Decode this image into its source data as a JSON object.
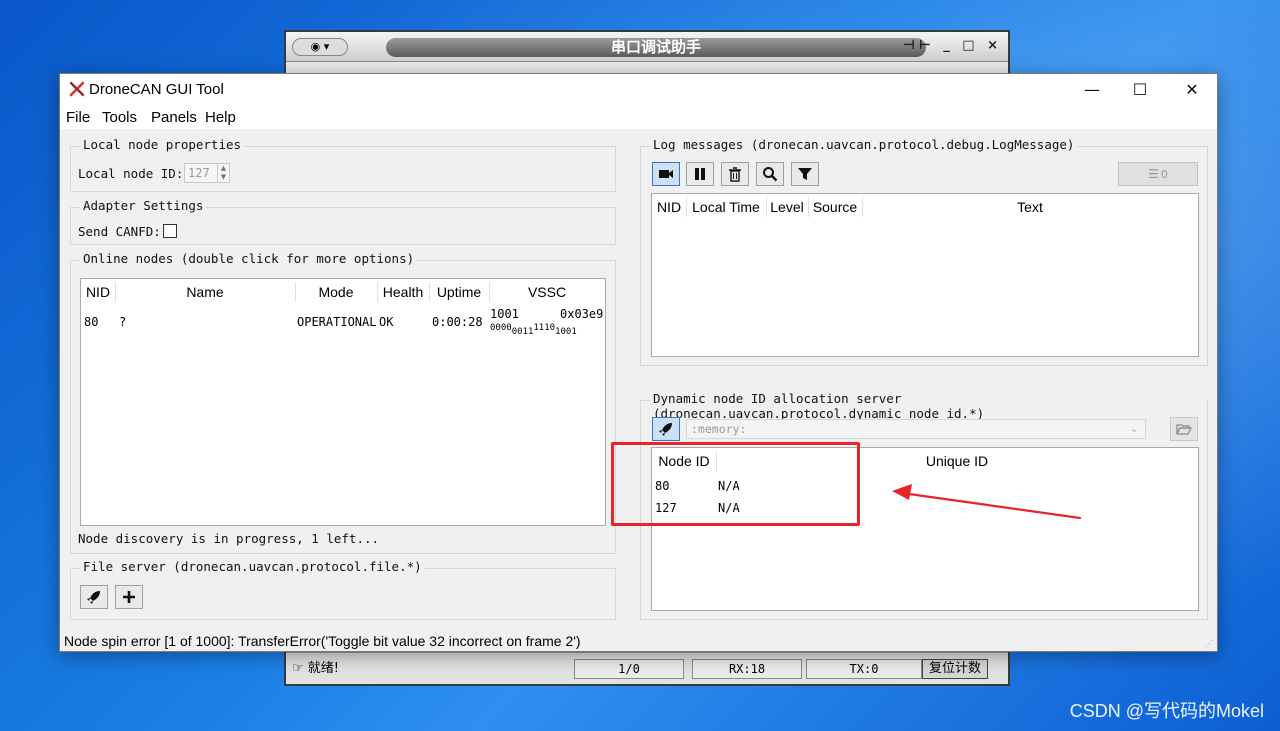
{
  "watermark": "CSDN @写代码的Mokel",
  "serial": {
    "title": "串口调试助手",
    "menu_glyph": "▾",
    "controls": [
      "⊣⊢",
      "_",
      "□",
      "×"
    ],
    "status": {
      "ready": "就绪!",
      "rx_tx_ratio": "1/0",
      "rx": "RX:18",
      "tx": "TX:0",
      "reset_btn": "复位计数"
    }
  },
  "window": {
    "title": "DroneCAN GUI Tool",
    "controls": {
      "minimize": "—",
      "maximize": "☐",
      "close": "✕"
    }
  },
  "menu": [
    "File",
    "Tools",
    "Panels",
    "Help"
  ],
  "local_node": {
    "group_title": "Local node properties",
    "id_label": "Local node ID:",
    "id_value": "127"
  },
  "adapter": {
    "group_title": "Adapter Settings",
    "canfd_label": "Send CANFD:",
    "canfd_checked": false
  },
  "online_nodes": {
    "group_title": "Online nodes (double click for more options)",
    "columns": [
      "NID",
      "Name",
      "Mode",
      "Health",
      "Uptime",
      "VSSC"
    ],
    "rows": [
      {
        "nid": "80",
        "name": "?",
        "mode": "OPERATIONAL",
        "health": "OK",
        "uptime": "0:00:28",
        "vssc_dec": "1001",
        "vssc_hex": "0x03e9",
        "vssc_bits": [
          "0000",
          "0011",
          "1110",
          "1001"
        ]
      }
    ],
    "footer": "Node discovery is in progress, 1 left..."
  },
  "file_server": {
    "group_title": "File server (dronecan.uavcan.protocol.file.*)",
    "buttons": [
      "rocket-icon",
      "plus-icon"
    ]
  },
  "log_messages": {
    "group_title": "Log messages (dronecan.uavcan.protocol.debug.LogMessage)",
    "toolbar": [
      "camera-icon",
      "pause-icon",
      "trash-icon",
      "search-icon",
      "filter-icon"
    ],
    "counter": "0",
    "columns": [
      "NID",
      "Local Time",
      "Level",
      "Source",
      "Text"
    ]
  },
  "dna_server": {
    "group_title": "Dynamic node ID allocation server (dronecan.uavcan.protocol.dynamic_node_id.*)",
    "storage_path": ":memory:",
    "columns": [
      "Node ID",
      "Unique ID"
    ],
    "rows": [
      {
        "node_id": "80",
        "unique_id": "N/A"
      },
      {
        "node_id": "127",
        "unique_id": "N/A"
      }
    ]
  },
  "status_bar": "Node spin error [1 of 1000]: TransferError('Toggle bit value 32 incorrect on frame 2')",
  "colors": {
    "annotation": "#e8232b",
    "desktop": "#1a7fe6"
  }
}
